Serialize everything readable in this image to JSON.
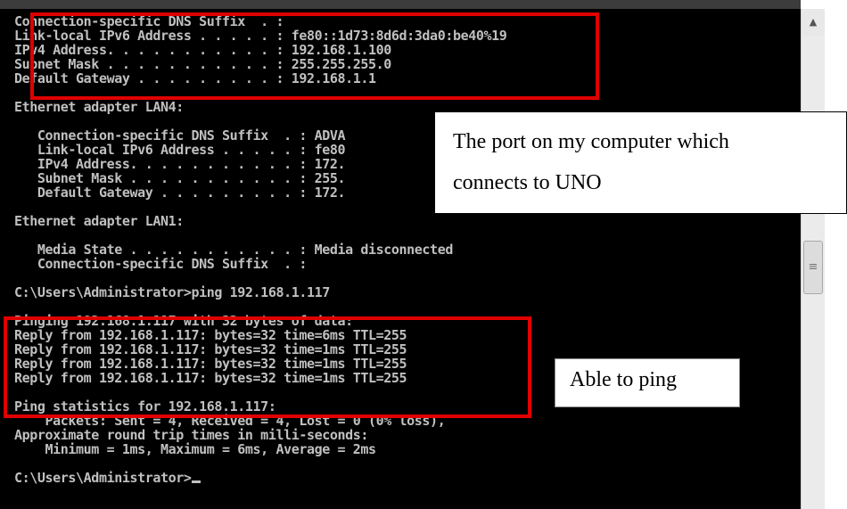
{
  "console": {
    "lines": [
      "Connection-specific DNS Suffix  . :",
      "Link-local IPv6 Address . . . . . : fe80::1d73:8d6d:3da0:be40%19",
      "IPv4 Address. . . . . . . . . . . : 192.168.1.100",
      "Subnet Mask . . . . . . . . . . . : 255.255.255.0",
      "Default Gateway . . . . . . . . . : 192.168.1.1",
      "",
      "Ethernet adapter LAN4:",
      "",
      "   Connection-specific DNS Suffix  . : ADVA",
      "   Link-local IPv6 Address . . . . . : fe80",
      "   IPv4 Address. . . . . . . . . . . : 172.",
      "   Subnet Mask . . . . . . . . . . . : 255.",
      "   Default Gateway . . . . . . . . . : 172.",
      "",
      "Ethernet adapter LAN1:",
      "",
      "   Media State . . . . . . . . . . . : Media disconnected",
      "   Connection-specific DNS Suffix  . :",
      "",
      "C:\\Users\\Administrator>ping 192.168.1.117",
      "",
      "Pinging 192.168.1.117 with 32 bytes of data:",
      "Reply from 192.168.1.117: bytes=32 time=6ms TTL=255",
      "Reply from 192.168.1.117: bytes=32 time=1ms TTL=255",
      "Reply from 192.168.1.117: bytes=32 time=1ms TTL=255",
      "Reply from 192.168.1.117: bytes=32 time=1ms TTL=255",
      "",
      "Ping statistics for 192.168.1.117:",
      "    Packets: Sent = 4, Received = 4, Lost = 0 (0% loss),",
      "Approximate round trip times in milli-seconds:",
      "    Minimum = 1ms, Maximum = 6ms, Average = 2ms",
      "",
      "C:\\Users\\Administrator>"
    ]
  },
  "annotations": {
    "port_line1": "The port on my computer which",
    "port_line2": "connects to UNO",
    "ping_label": "Able to ping"
  },
  "scrollbar": {
    "up_arrow_icon": "arrow-up-icon",
    "thumb_grip_icon": "grip-icon"
  }
}
